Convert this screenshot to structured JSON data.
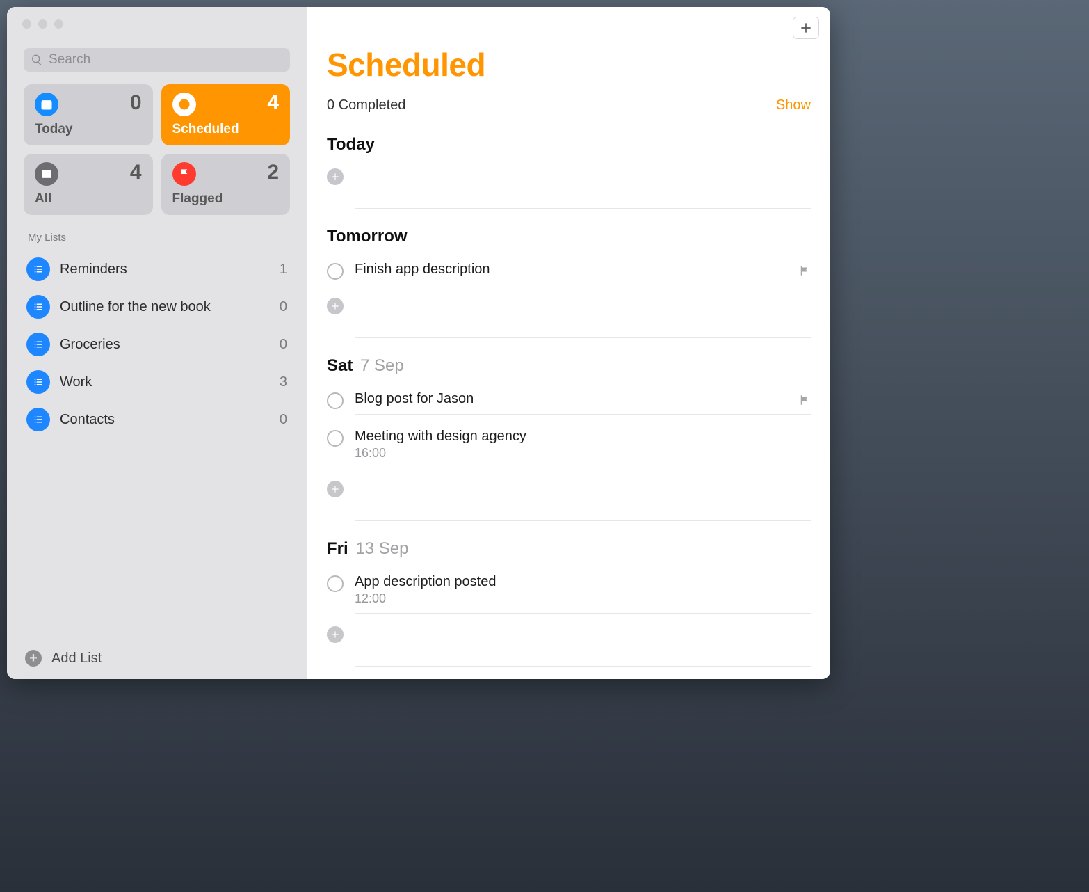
{
  "search": {
    "placeholder": "Search"
  },
  "smart": {
    "today": {
      "label": "Today",
      "count": 0
    },
    "scheduled": {
      "label": "Scheduled",
      "count": 4
    },
    "all": {
      "label": "All",
      "count": 4
    },
    "flagged": {
      "label": "Flagged",
      "count": 2
    }
  },
  "sidebar": {
    "section": "My Lists",
    "lists": [
      {
        "name": "Reminders",
        "count": 1
      },
      {
        "name": "Outline for the new book",
        "count": 0
      },
      {
        "name": "Groceries",
        "count": 0
      },
      {
        "name": "Work",
        "count": 3
      },
      {
        "name": "Contacts",
        "count": 0
      }
    ],
    "add": "Add List"
  },
  "colors": {
    "accent": "#ff9500"
  },
  "main": {
    "title": "Scheduled",
    "completed": {
      "text": "0 Completed",
      "show": "Show"
    },
    "sections": [
      {
        "head": "Today",
        "sub": "",
        "items": []
      },
      {
        "head": "Tomorrow",
        "sub": "",
        "items": [
          {
            "title": "Finish app description",
            "time": "",
            "flagged": true
          }
        ]
      },
      {
        "head": "Sat",
        "sub": "7 Sep",
        "items": [
          {
            "title": "Blog post for Jason",
            "time": "",
            "flagged": true
          },
          {
            "title": "Meeting with design agency",
            "time": "16:00",
            "flagged": false
          }
        ]
      },
      {
        "head": "Fri",
        "sub": "13 Sep",
        "items": [
          {
            "title": "App description posted",
            "time": "12:00",
            "flagged": false
          }
        ]
      }
    ]
  }
}
